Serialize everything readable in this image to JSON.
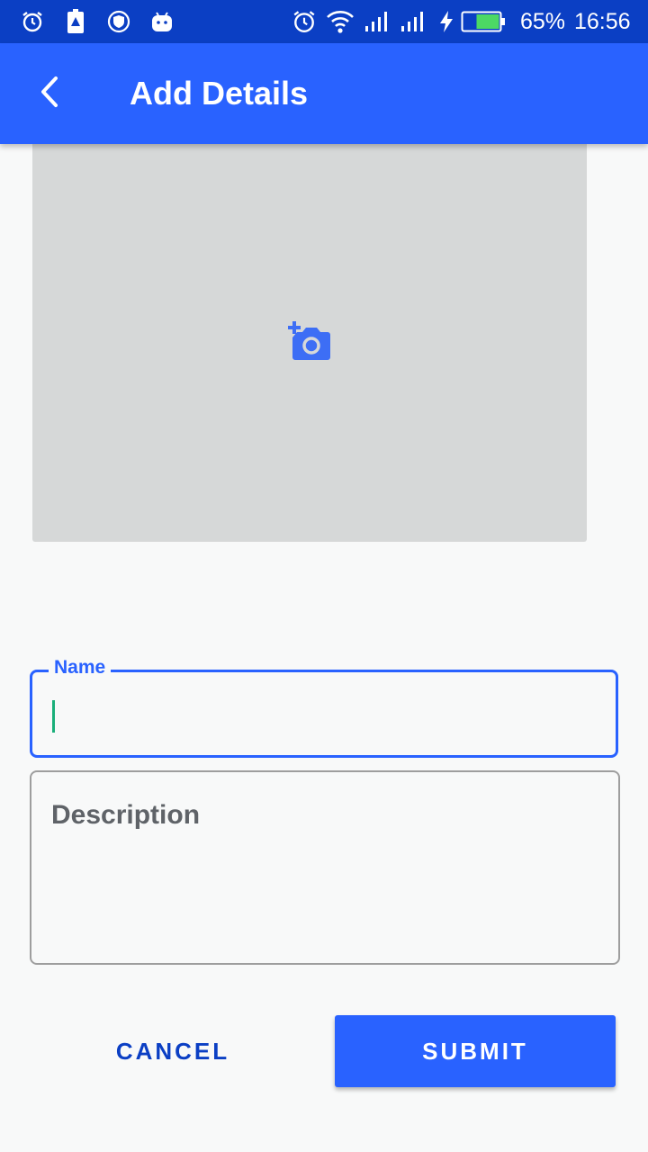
{
  "status_bar": {
    "left_icons": [
      "alarm-icon",
      "battery-warning-icon",
      "shield-icon",
      "android-icon"
    ],
    "right_icons": [
      "alarm-icon",
      "wifi-icon",
      "signal-icon",
      "signal-icon",
      "charging-icon",
      "battery-icon"
    ],
    "battery_percent": "65%",
    "battery_level": 0.65,
    "time": "16:56"
  },
  "app_bar": {
    "title": "Add Details",
    "back_icon": "chevron-left-icon"
  },
  "image_picker": {
    "icon": "add-photo-icon"
  },
  "form": {
    "name_label": "Name",
    "name_value": "",
    "description_placeholder": "Description",
    "description_value": ""
  },
  "actions": {
    "cancel_label": "CANCEL",
    "submit_label": "SUBMIT"
  },
  "colors": {
    "primary": "#2962ff",
    "status_bar": "#0b3fc4",
    "caret": "#1aaf7a",
    "placeholder_bg": "#d6d8d8"
  }
}
